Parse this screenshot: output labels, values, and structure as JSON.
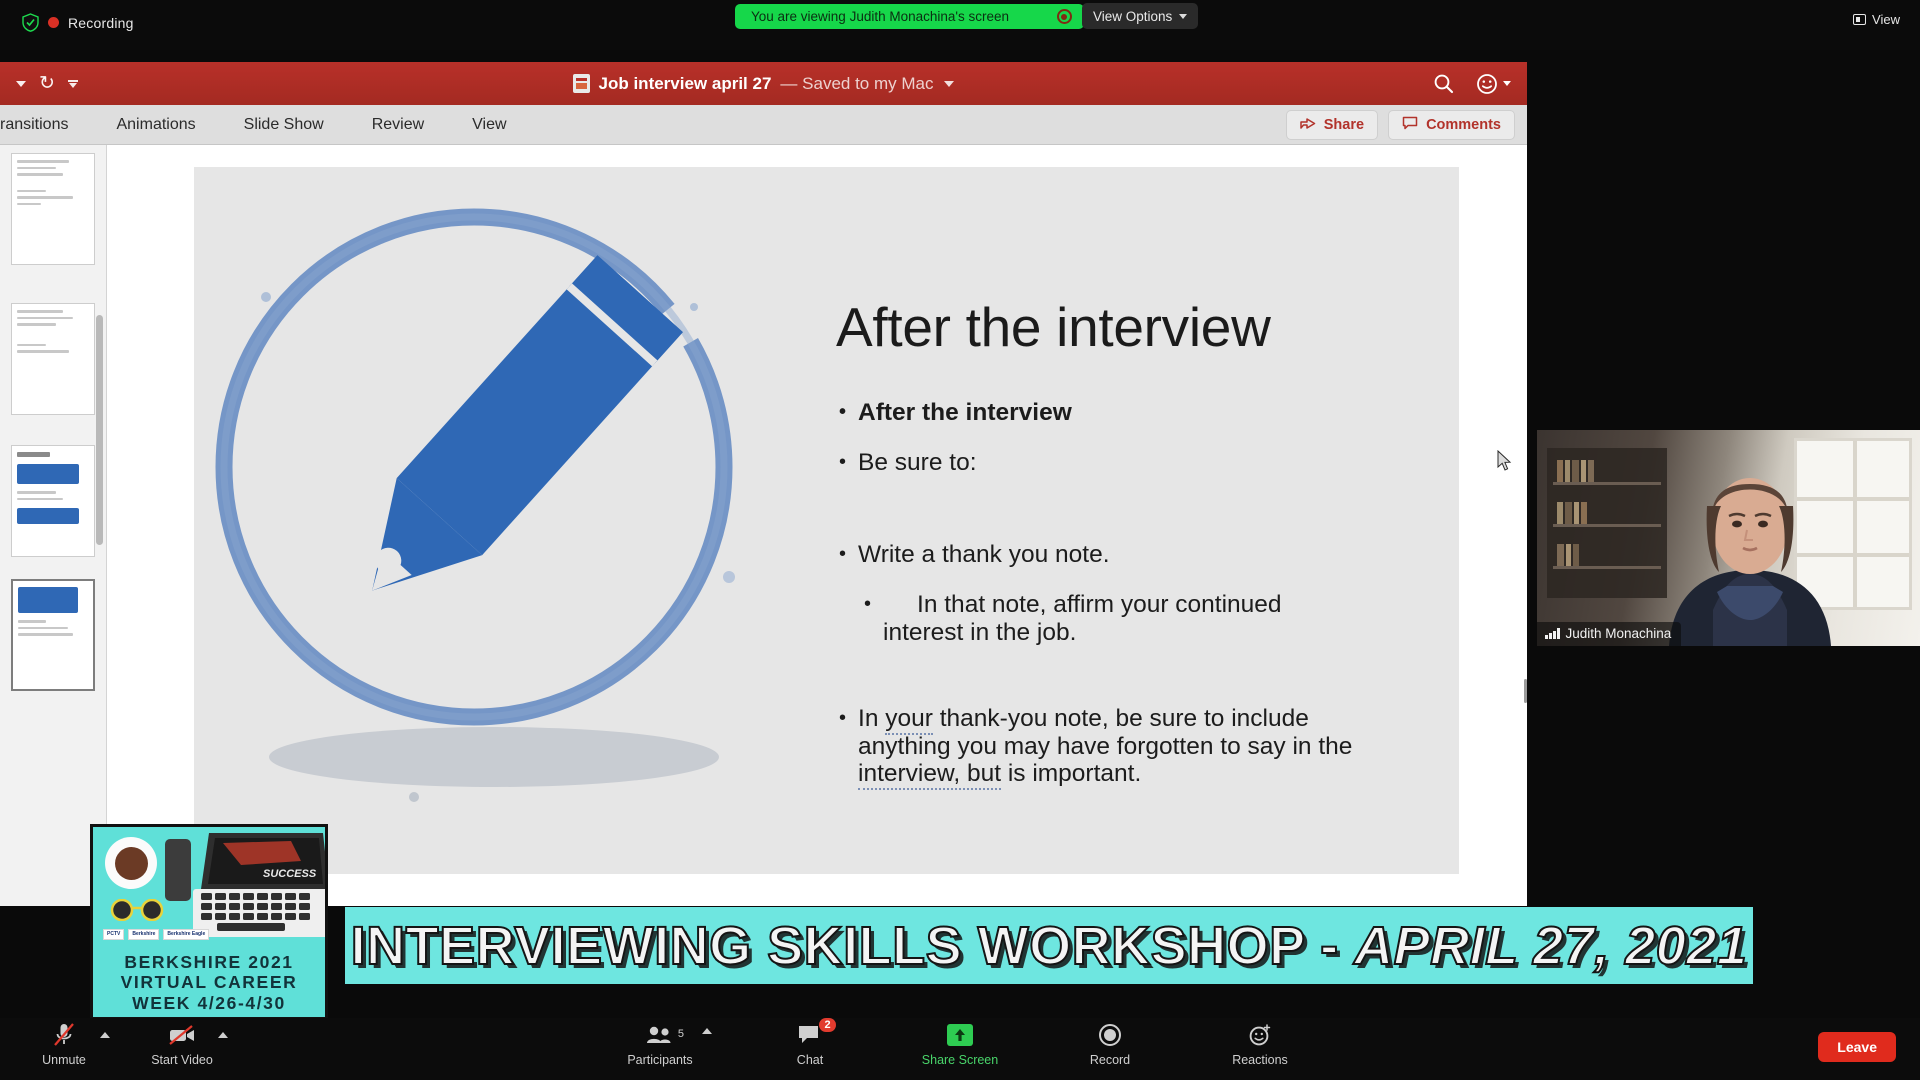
{
  "zoom_top": {
    "recording_label": "Recording",
    "shield_icon": "security-shield-icon",
    "viewing_banner": "You are viewing Judith Monachina's screen",
    "viewing_banner_color": "#16d74a",
    "view_options_label": "View Options",
    "view_button_label": "View"
  },
  "powerpoint": {
    "doc_title": "Job interview april 27",
    "doc_saved_state": "— Saved to my Mac",
    "ribbon_tabs": [
      "ransitions",
      "Animations",
      "Slide Show",
      "Review",
      "View"
    ],
    "share_label": "Share",
    "comments_label": "Comments",
    "titlebar_color": "#b83029",
    "accent_text_color": "#b2332b"
  },
  "slide": {
    "title": "After the interview",
    "bullets": [
      {
        "text": "After the interview",
        "style": "bold",
        "level": 1
      },
      {
        "text": "Be sure to:",
        "style": "normal",
        "level": 1
      },
      {
        "text": "Write a thank you note.",
        "style": "normal",
        "level": 1
      },
      {
        "text": "In that note, affirm your continued interest in the job.",
        "style": "normal",
        "level": 2
      }
    ],
    "final_paragraph_pre": "In ",
    "final_paragraph_sp1": "your",
    "final_paragraph_mid": " thank-you note, be sure to include anything you may have forgotten to say in the ",
    "final_paragraph_sp2": "interview, but",
    "final_paragraph_post": " is important."
  },
  "banner": {
    "main_text": "INTERVIEWING SKILLS WORKSHOP - ",
    "date_text": "APRIL 27, 2021",
    "background_color": "#6ee6e0"
  },
  "flyer": {
    "line1": "BERKSHIRE 2021",
    "line2": "VIRTUAL CAREER",
    "line3": "WEEK 4/26-4/30",
    "screen_word": "SUCCESS",
    "logos": [
      "PCTV",
      "Berkshire",
      "Berkshire Eagle"
    ],
    "background_color": "#5fe0d8"
  },
  "video_tile": {
    "participant_name": "Judith Monachina",
    "audio_icon": "audio-bars-icon"
  },
  "zoom_bottom": {
    "mute_label": "Unmute",
    "video_label": "Start Video",
    "participants_label": "Participants",
    "participants_count": "5",
    "chat_label": "Chat",
    "chat_badge": "2",
    "share_screen_label": "Share Screen",
    "record_label": "Record",
    "reactions_label": "Reactions",
    "leave_label": "Leave",
    "active_color": "#49d46a",
    "leave_color": "#e02b1d"
  }
}
